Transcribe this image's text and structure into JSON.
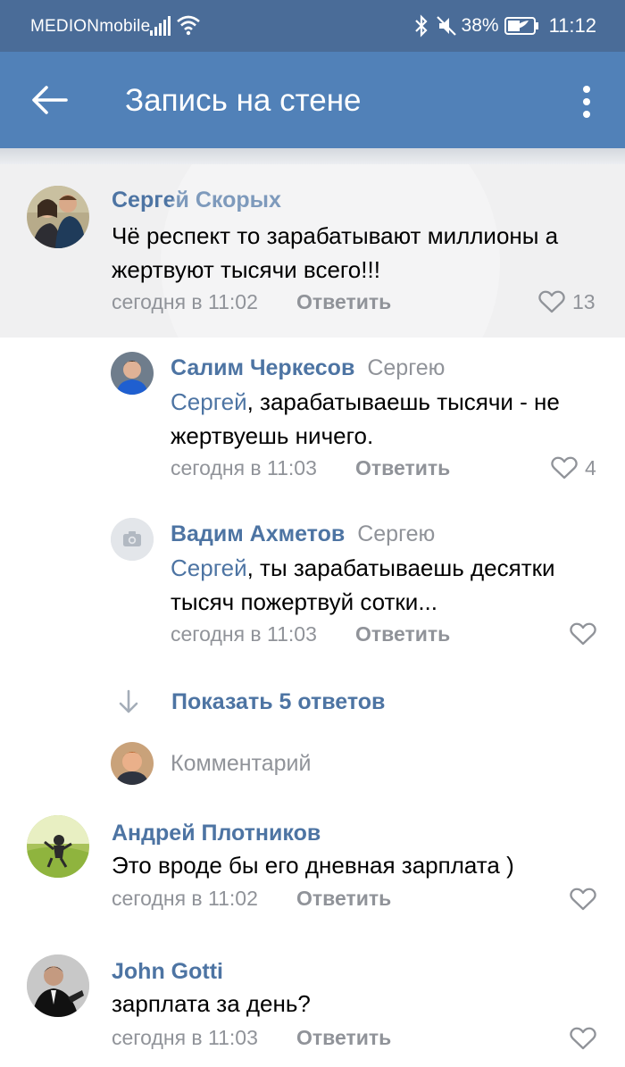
{
  "status_bar": {
    "carrier": "MEDIONmobile",
    "battery": "38%",
    "time": "11:12",
    "icons": [
      "signal-icon",
      "wifi-icon",
      "bluetooth-icon",
      "mute-icon",
      "battery-icon"
    ]
  },
  "app_bar": {
    "title": "Запись на стене",
    "back_icon": "arrow-left-icon",
    "menu_icon": "more-vertical-icon"
  },
  "colors": {
    "status_bar": "#4a6c98",
    "app_bar": "#5181b8",
    "link": "#4d74a3",
    "secondary": "#909399"
  },
  "comments": [
    {
      "author": "Сергей Скорых",
      "text": "Чё  респект то зарабатывают миллионы а жертвуют тысячи всего!!!",
      "time": "сегодня в 11:02",
      "reply_label": "Ответить",
      "likes": "13"
    },
    {
      "author": "Салим Черкесов",
      "reply_to": "Сергею",
      "mention": "Сергей",
      "text": ", зарабатываешь тысячи - не жертвуешь ничего.",
      "time": "сегодня в 11:03",
      "reply_label": "Ответить",
      "likes": "4"
    },
    {
      "author": "Вадим Ахметов",
      "reply_to": "Сергею",
      "mention": "Сергей",
      "text": ", ты зарабатываешь десятки тысяч пожертвуй сотки...",
      "time": "сегодня в 11:03",
      "reply_label": "Ответить",
      "likes": ""
    },
    {
      "author": "Андрей Плотников",
      "text": "Это вроде бы его дневная зарплата )",
      "time": "сегодня в 11:02",
      "reply_label": "Ответить",
      "likes": ""
    },
    {
      "author": "John Gotti",
      "text": "зарплата за день?",
      "time": "сегодня в 11:03",
      "reply_label": "Ответить",
      "likes": ""
    }
  ],
  "show_replies": "Показать 5 ответов",
  "comment_input": {
    "placeholder": "Комментарий"
  }
}
